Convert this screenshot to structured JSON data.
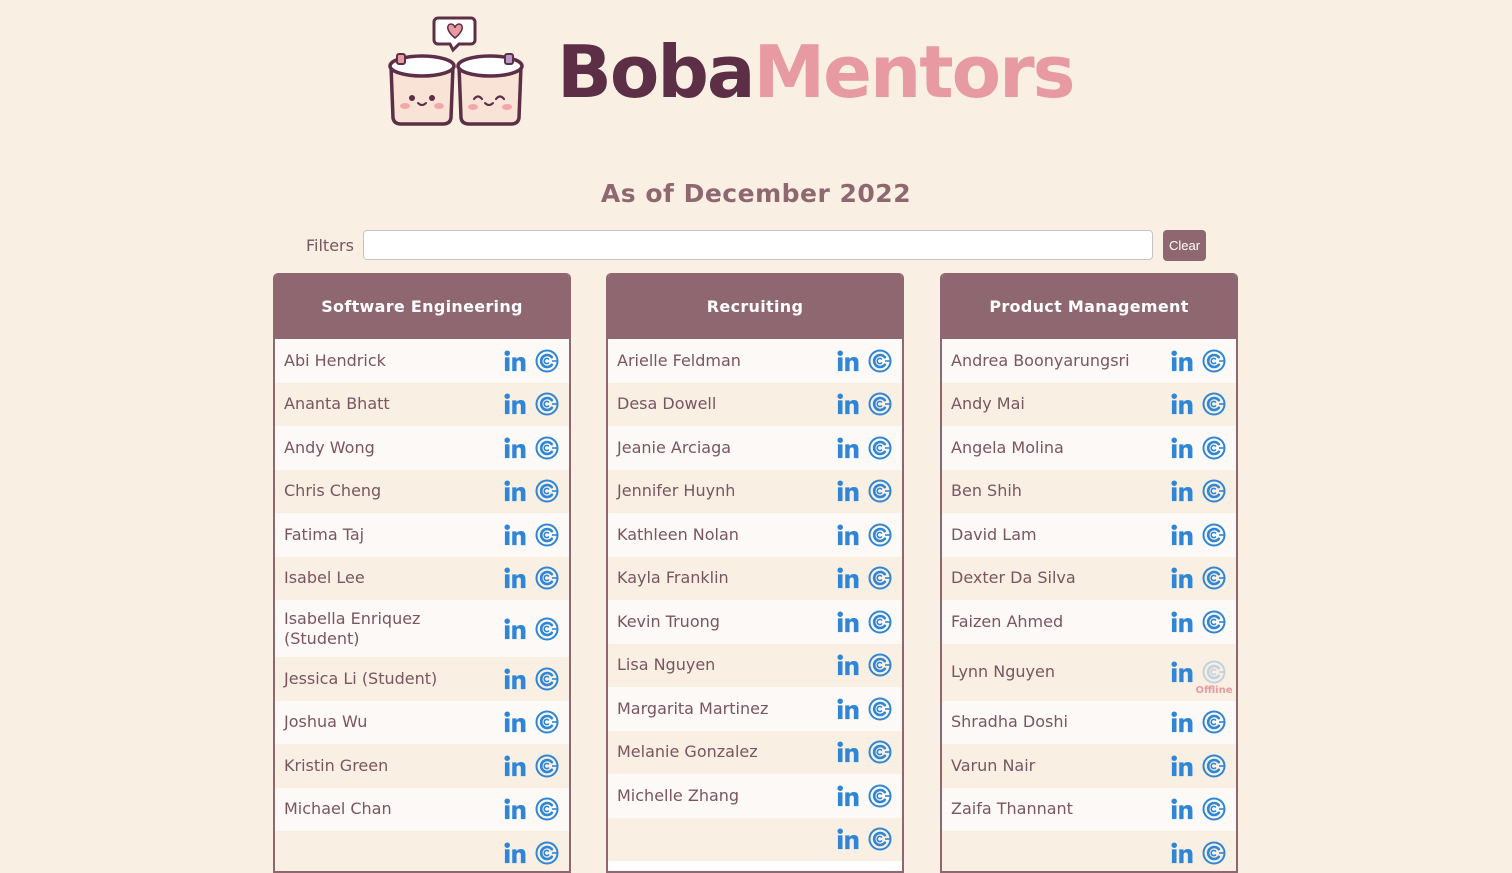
{
  "logo": {
    "word1": "Boba",
    "word2": "Mentors",
    "colors": {
      "dark": "#5c2f47",
      "pink": "#e79aa1"
    }
  },
  "subtitle": "As of December 2022",
  "filters": {
    "label": "Filters",
    "value": "",
    "placeholder": "",
    "clear_label": "Clear"
  },
  "colors": {
    "background": "#f9efe3",
    "accent": "#8e6771",
    "link_blue": "#2f86d6",
    "offline": "#e79aa1"
  },
  "icons": {
    "profile": "linkedin-icon",
    "booking": "calendly-icon"
  },
  "columns": [
    {
      "title": "Software Engineering",
      "mentors": [
        {
          "name": "Abi Hendrick"
        },
        {
          "name": "Ananta Bhatt"
        },
        {
          "name": "Andy Wong"
        },
        {
          "name": "Chris Cheng"
        },
        {
          "name": "Fatima Taj"
        },
        {
          "name": "Isabel Lee"
        },
        {
          "name": "Isabella Enriquez (Student)"
        },
        {
          "name": "Jessica Li (Student)"
        },
        {
          "name": "Joshua Wu"
        },
        {
          "name": "Kristin Green"
        },
        {
          "name": "Michael Chan"
        },
        {
          "name": ""
        }
      ]
    },
    {
      "title": "Recruiting",
      "mentors": [
        {
          "name": "Arielle Feldman"
        },
        {
          "name": "Desa Dowell"
        },
        {
          "name": "Jeanie Arciaga"
        },
        {
          "name": "Jennifer Huynh"
        },
        {
          "name": "Kathleen Nolan"
        },
        {
          "name": "Kayla Franklin"
        },
        {
          "name": "Kevin Truong"
        },
        {
          "name": "Lisa Nguyen"
        },
        {
          "name": "Margarita Martinez"
        },
        {
          "name": "Melanie Gonzalez"
        },
        {
          "name": "Michelle Zhang"
        },
        {
          "name": ""
        }
      ]
    },
    {
      "title": "Product Management",
      "mentors": [
        {
          "name": "Andrea Boonyarungsri"
        },
        {
          "name": "Andy Mai"
        },
        {
          "name": "Angela Molina"
        },
        {
          "name": "Ben Shih"
        },
        {
          "name": "David Lam"
        },
        {
          "name": "Dexter Da Silva"
        },
        {
          "name": "Faizen Ahmed"
        },
        {
          "name": "Lynn Nguyen",
          "offline": true,
          "status": "Offline"
        },
        {
          "name": "Shradha Doshi"
        },
        {
          "name": "Varun Nair"
        },
        {
          "name": "Zaifa Thannant"
        },
        {
          "name": ""
        }
      ]
    }
  ]
}
